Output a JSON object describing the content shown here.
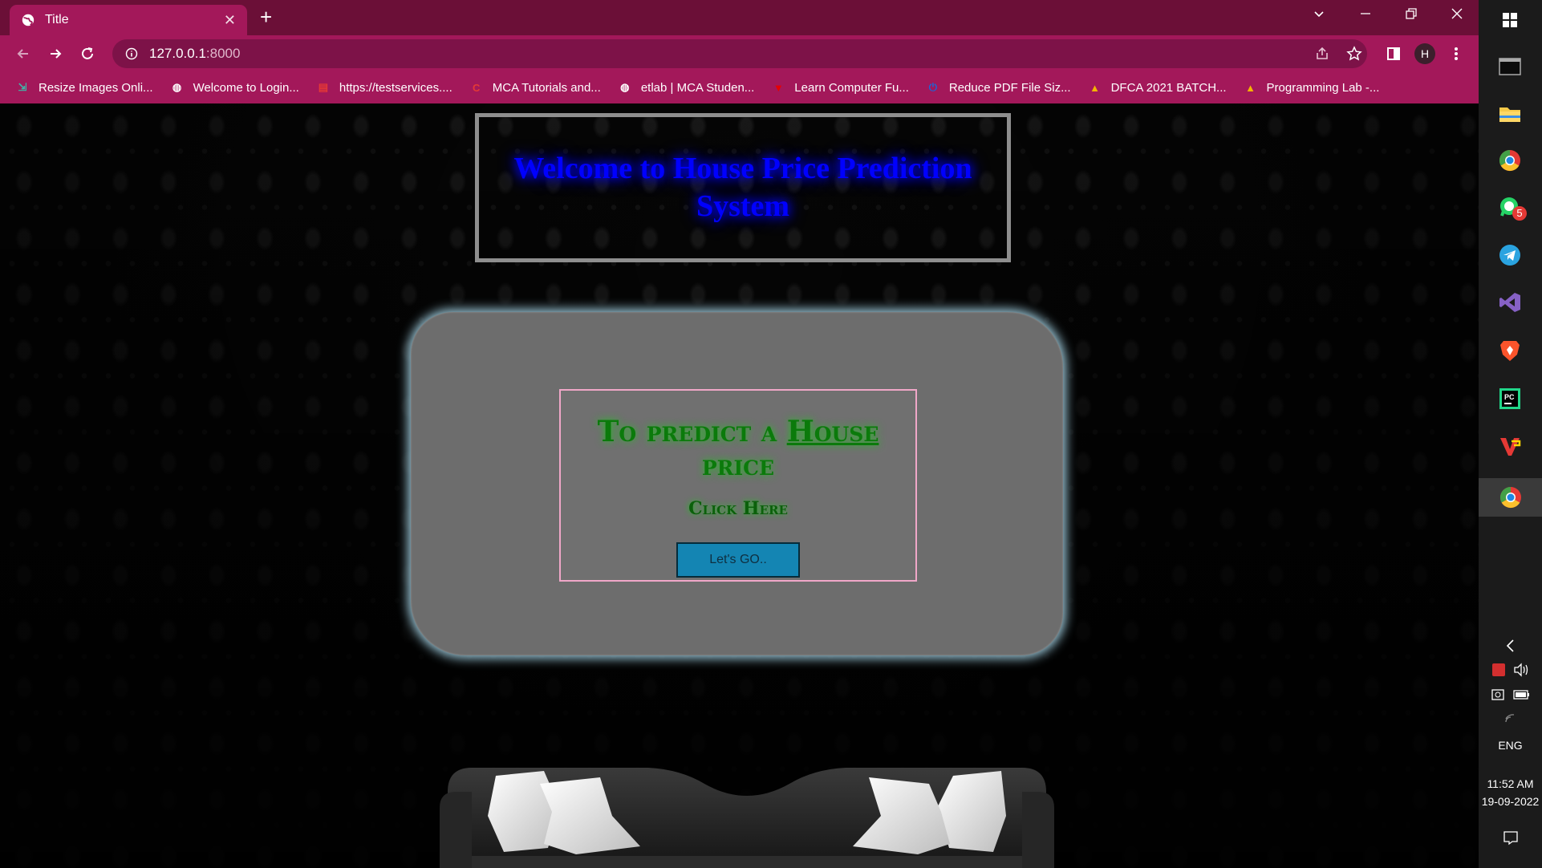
{
  "browser": {
    "tab_title": "Title",
    "url_host": "127.0.0.1",
    "url_port": ":8000",
    "profile_initial": "H",
    "bookmarks": [
      {
        "label": "Resize Images Onli...",
        "icon": "resize-icon",
        "color": "#3fb6a8"
      },
      {
        "label": "Welcome to Login...",
        "icon": "globe-icon",
        "color": "#ffffff"
      },
      {
        "label": "https://testservices....",
        "icon": "doc-icon",
        "color": "#e53935"
      },
      {
        "label": "MCA Tutorials and...",
        "icon": "c-logo-icon",
        "color": "#e53935"
      },
      {
        "label": "etlab | MCA Studen...",
        "icon": "globe-icon",
        "color": "#ffffff"
      },
      {
        "label": "Learn Computer Fu...",
        "icon": "v-logo-icon",
        "color": "#e60000"
      },
      {
        "label": "Reduce PDF File Siz...",
        "icon": "power-icon",
        "color": "#1e63d6"
      },
      {
        "label": "DFCA 2021 BATCH...",
        "icon": "drive-icon",
        "color": "#f4b400"
      },
      {
        "label": "Programming Lab -...",
        "icon": "drive-icon",
        "color": "#f4b400"
      }
    ]
  },
  "page": {
    "header_title": "Welcome to House Price Prediction System",
    "predict_title_before": "To predict a ",
    "predict_title_house": "House",
    "predict_title_after": " price",
    "click_here": "Click Here",
    "button_label": "Let's GO.."
  },
  "taskbar": {
    "whatsapp_badge": "5",
    "language": "ENG",
    "time": "11:52 AM",
    "date": "19-09-2022"
  },
  "colors": {
    "chrome_dark": "#6b0f37",
    "chrome_accent": "#a3185a",
    "header_text": "#0000ff",
    "predict_text": "#0b7a0b",
    "button_bg": "#1485b3"
  }
}
